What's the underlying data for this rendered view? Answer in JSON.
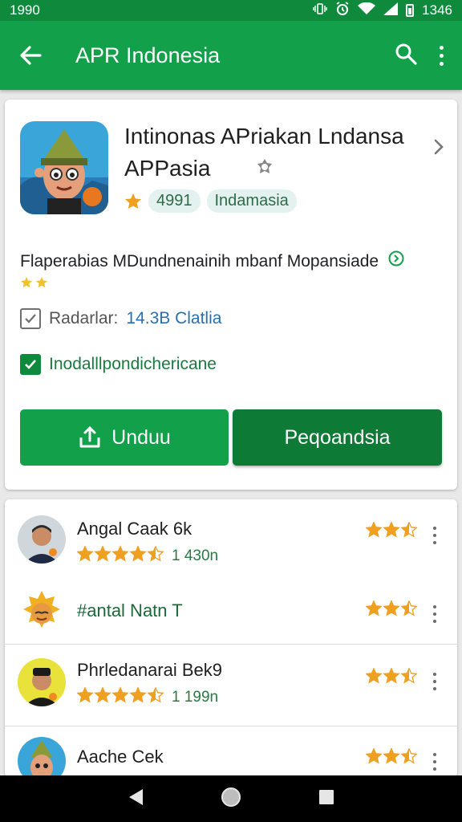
{
  "status_bar": {
    "time": "1990",
    "right_time": "1346"
  },
  "app_bar": {
    "title": "APR Indonesia"
  },
  "app": {
    "title": "Intinonas APriakan Lndansa APPasia",
    "rating": "4991",
    "category": "Indamasia",
    "description": "Flaperabias MDundnenainih mbanf Mopansiade",
    "row1_label": "Radarlar:",
    "row1_value": "14.3B Clatlia",
    "row2_label": "Inodalllpondichericane",
    "btn_primary": "Unduu",
    "btn_secondary": "Peqoandsia"
  },
  "reviews": [
    {
      "name": "Angal Caak 6k",
      "count": "1 430n",
      "stars": 4.5,
      "right_stars": 2.5
    },
    {
      "name": "#antal Natn T",
      "count": "",
      "stars": 0,
      "right_stars": 2.5
    },
    {
      "name": "Phrledanarai Bek9",
      "count": "1 199n",
      "stars": 4.5,
      "right_stars": 2.5
    },
    {
      "name": "Aache Cek",
      "count": "",
      "stars": 0,
      "right_stars": 2.5
    }
  ],
  "colors": {
    "primary": "#12a04a",
    "primary_dark": "#0f8a3c",
    "button_dark": "#0d7a36",
    "star": "#f0a020"
  },
  "icons": [
    "back-arrow-icon",
    "search-icon",
    "more-vert-icon",
    "chevron-right-icon",
    "shield-badge-icon",
    "verified-icon",
    "download-icon",
    "back-nav-icon",
    "home-nav-icon",
    "recents-nav-icon"
  ]
}
